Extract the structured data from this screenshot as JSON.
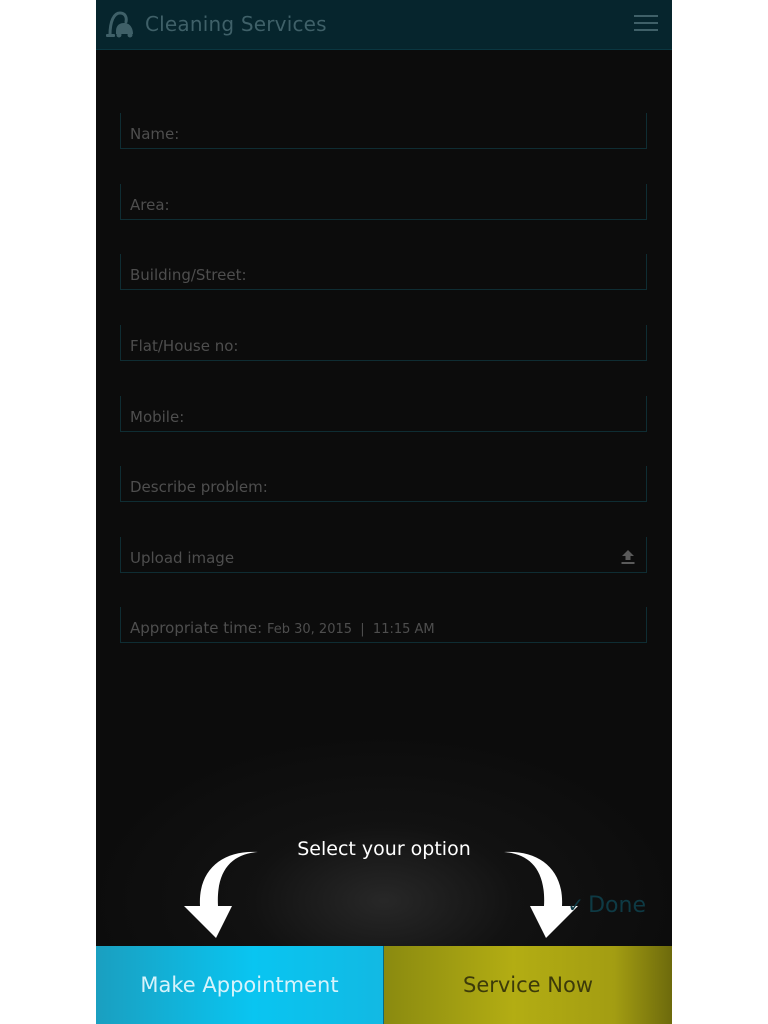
{
  "app": {
    "title": "Cleaning Services",
    "logo_icon": "vacuum-cleaner-icon",
    "menu_icon": "hamburger-menu-icon"
  },
  "form": {
    "fields": [
      {
        "label": "Name:",
        "value": ""
      },
      {
        "label": "Area:",
        "value": ""
      },
      {
        "label": "Building/Street:",
        "value": ""
      },
      {
        "label": "Flat/House no:",
        "value": ""
      },
      {
        "label": "Mobile:",
        "value": ""
      },
      {
        "label": "Describe problem:",
        "value": ""
      },
      {
        "label": "Upload image",
        "value": "",
        "icon": "upload-icon"
      },
      {
        "label": "Appropriate time:",
        "value": "Feb 30, 2015  |  11:15 AM"
      }
    ]
  },
  "overlay": {
    "hint": "Select your option",
    "done_label": "Done",
    "done_icon": "checkmark-icon"
  },
  "actions": {
    "appointment_label": "Make Appointment",
    "service_label": "Service Now"
  },
  "colors": {
    "appbar": "#06252d",
    "background": "#0c0c0c",
    "appointment_button": "#09c5f1",
    "service_button": "#b3ad13"
  }
}
